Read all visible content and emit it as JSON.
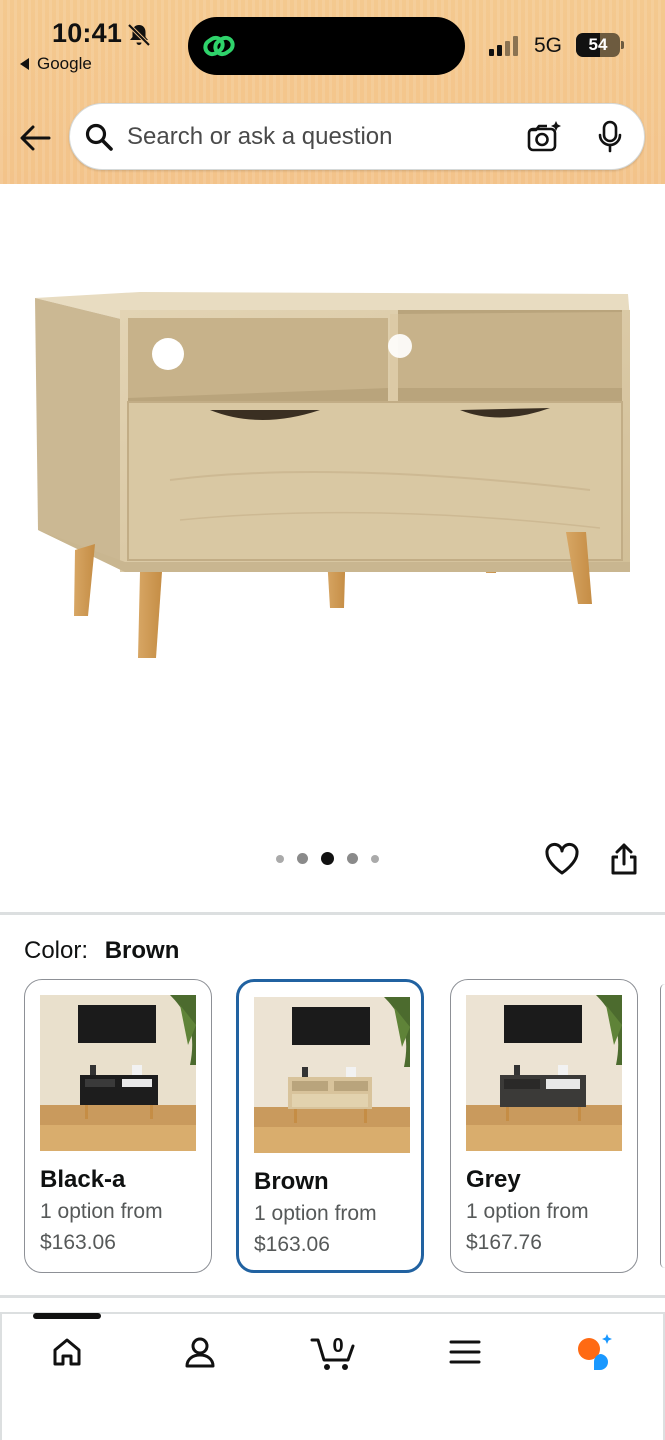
{
  "status_bar": {
    "time": "10:41",
    "back_app": "Google",
    "network": "5G",
    "battery": "54",
    "battery_level": 0.54
  },
  "search": {
    "placeholder": "Search or ask a question"
  },
  "gallery": {
    "image_count": 5,
    "active_index": 2
  },
  "variation": {
    "label": "Color:",
    "selected": "Brown"
  },
  "swatches": [
    {
      "name": "Black-a",
      "availability": "1 option from",
      "price": "$163.06",
      "cabinet_color": "#1d1d1d"
    },
    {
      "name": "Brown",
      "availability": "1 option from",
      "price": "$163.06",
      "cabinet_color": "#d8c39b"
    },
    {
      "name": "Grey",
      "availability": "1 option from",
      "price": "$167.76",
      "cabinet_color": "#3b3a38"
    }
  ],
  "bottom_nav": {
    "cart_count": "0",
    "items": [
      "home",
      "account",
      "cart",
      "menu",
      "rufus"
    ]
  },
  "colors": {
    "header_bg": "#f3c38a",
    "selected_border": "#2162a1",
    "rufus_orange": "#ff6a13",
    "rufus_blue": "#1a98ff"
  }
}
